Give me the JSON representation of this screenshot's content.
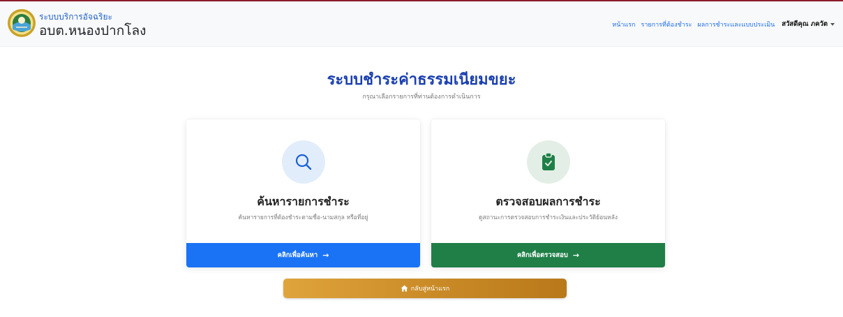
{
  "brand": {
    "subtitle": "ระบบบริการอัจฉริยะ",
    "name": "อบต.หนองปากโลง"
  },
  "nav": {
    "items": [
      {
        "label": "หน้าแรก"
      },
      {
        "label": "รายการที่ต้องชำระ"
      },
      {
        "label": "ผลการชำระและแบบประเมิน"
      }
    ],
    "user_label": "สวัสดีคุณ ภควัต"
  },
  "page": {
    "title": "ระบบชำระค่าธรรมเนียมขยะ",
    "subtitle": "กรุณาเลือกรายการที่ท่านต้องการดำเนินการ"
  },
  "cards": [
    {
      "icon": "search-icon",
      "title": "ค้นหารายการชำระ",
      "description": "ค้นหารายการที่ต้องชำระตามชื่อ-นามสกุล หรือที่อยู่",
      "button_label": "คลิกเพื่อค้นหา",
      "button_color": "#1a73f5"
    },
    {
      "icon": "clipboard-check-icon",
      "title": "ตรวจสอบผลการชำระ",
      "description": "ดูสถานะการตรวจสอบการชำระเงินและประวัติย้อนหลัง",
      "button_label": "คลิกเพื่อตรวจสอบ",
      "button_color": "#1f7f47"
    }
  ],
  "home_button": {
    "label": "กลับสู่หน้าแรก",
    "icon": "home-icon"
  },
  "colors": {
    "accent_line": "#8b1a2b",
    "title": "#1a3fb0",
    "link": "#1f6feb",
    "home_button": "#c98a26"
  }
}
